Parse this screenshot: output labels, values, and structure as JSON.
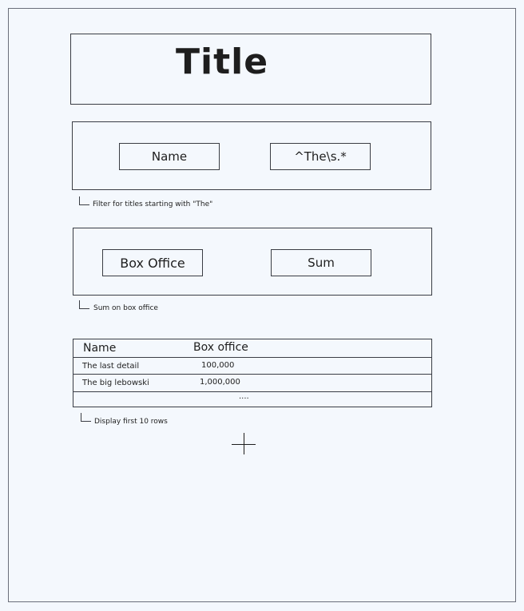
{
  "title": "Title",
  "filter": {
    "column": "Name",
    "pattern": "^The\\s.*",
    "note": "Filter for titles starting with \"The\""
  },
  "aggregate": {
    "column": "Box Office",
    "function": "Sum",
    "note": "Sum on box office"
  },
  "table": {
    "headers": [
      "Name",
      "Box office"
    ],
    "rows": [
      [
        "The last detail",
        "100,000"
      ],
      [
        "The big lebowski",
        "1,000,000"
      ]
    ],
    "ellipsis": "....",
    "note": "Display first 10 rows"
  }
}
